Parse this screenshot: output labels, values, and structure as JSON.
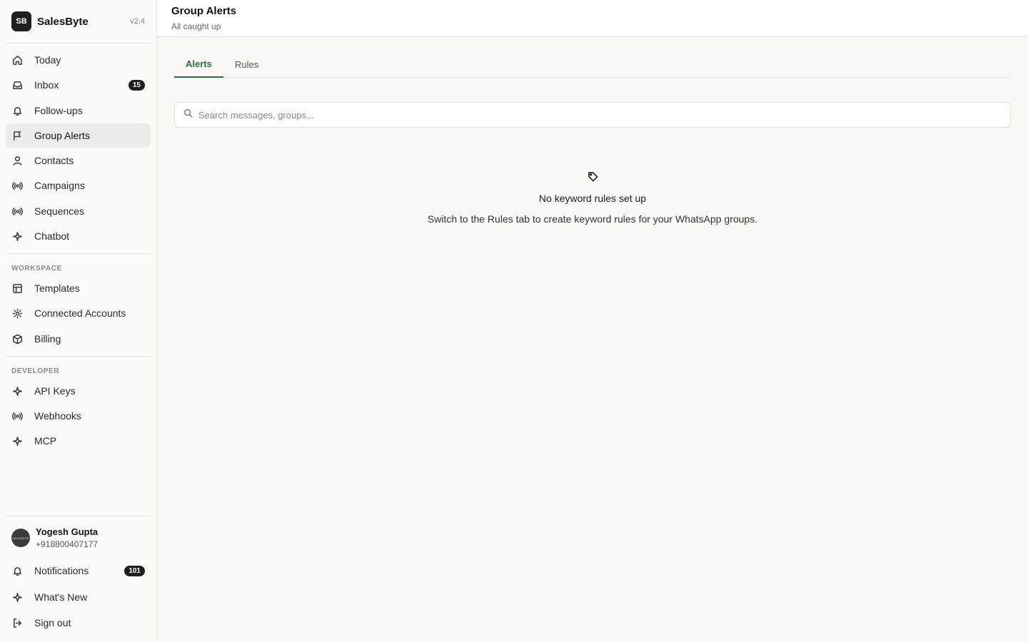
{
  "brand": {
    "logo": "SB",
    "name": "SalesByte",
    "version": "v2.4"
  },
  "nav": {
    "main": [
      {
        "label": "Today",
        "icon": "home-icon"
      },
      {
        "label": "Inbox",
        "icon": "inbox-icon",
        "badge": "15"
      },
      {
        "label": "Follow-ups",
        "icon": "bell-icon"
      },
      {
        "label": "Group Alerts",
        "icon": "flag-icon",
        "active": true
      },
      {
        "label": "Contacts",
        "icon": "user-icon"
      },
      {
        "label": "Campaigns",
        "icon": "broadcast-icon"
      },
      {
        "label": "Sequences",
        "icon": "broadcast-icon"
      },
      {
        "label": "Chatbot",
        "icon": "sparkle-icon"
      }
    ],
    "workspace_label": "WORKSPACE",
    "workspace": [
      {
        "label": "Templates",
        "icon": "layout-icon"
      },
      {
        "label": "Connected Accounts",
        "icon": "gear-icon"
      },
      {
        "label": "Billing",
        "icon": "box-icon"
      }
    ],
    "developer_label": "DEVELOPER",
    "developer": [
      {
        "label": "API Keys",
        "icon": "sparkle-icon"
      },
      {
        "label": "Webhooks",
        "icon": "broadcast-icon"
      },
      {
        "label": "MCP",
        "icon": "sparkle-icon"
      }
    ]
  },
  "user": {
    "avatar_text": "SALESBYTE",
    "name": "Yogesh Gupta",
    "phone": "+918800407177"
  },
  "footer": {
    "notifications": {
      "label": "Notifications",
      "badge": "101",
      "icon": "bell-icon"
    },
    "whats_new": {
      "label": "What's New",
      "icon": "sparkle-icon"
    },
    "sign_out": {
      "label": "Sign out",
      "icon": "logout-icon"
    }
  },
  "header": {
    "title": "Group Alerts",
    "subtitle": "All caught up"
  },
  "tabs": [
    {
      "label": "Alerts",
      "active": true
    },
    {
      "label": "Rules"
    }
  ],
  "search": {
    "placeholder": "Search messages, groups..."
  },
  "empty_state": {
    "icon": "tag-icon",
    "title": "No keyword rules set up",
    "description": "Switch to the Rules tab to create keyword rules for your WhatsApp groups."
  },
  "colors": {
    "accent": "#2e6b45",
    "badge": "#1e1e1e"
  }
}
